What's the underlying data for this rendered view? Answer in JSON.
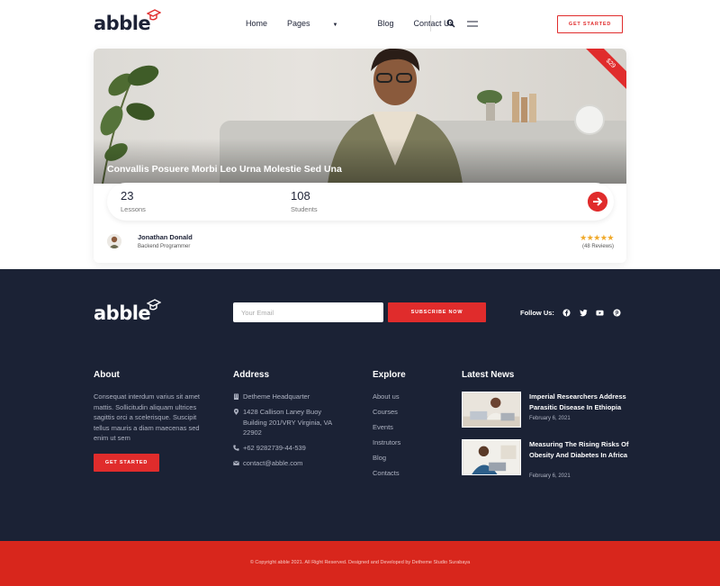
{
  "header": {
    "logo_text": "abble",
    "nav": [
      {
        "label": "Home"
      },
      {
        "label": "Pages"
      },
      {
        "label": "Blog"
      },
      {
        "label": "Contact Us"
      }
    ],
    "cta_label": "GET STARTED"
  },
  "course": {
    "price": "$29",
    "title": "Convallis Posuere Morbi Leo Urna Molestie Sed Una",
    "lessons_count": "23",
    "lessons_label": "Lessons",
    "students_count": "108",
    "students_label": "Students",
    "author_name": "Jonathan Donald",
    "author_role": "Backend Programmer",
    "rating_stars": "★★★★★",
    "reviews": "(48 Reviews)"
  },
  "footer": {
    "logo_text": "abble",
    "email_placeholder": "Your Email",
    "subscribe_label": "SUBSCRIBE NOW",
    "follow_label": "Follow Us:",
    "about": {
      "title": "About",
      "text": "Consequat interdum varius sit amet mattis. Sollicitudin aliquam ultrices sagittis orci a scelerisque. Suscipit tellus mauris a diam maecenas sed enim ut sem",
      "button": "GET STARTED"
    },
    "address": {
      "title": "Address",
      "hq": "Detheme Headquarter",
      "street": "1428 Callison Laney Buoy Building 201/VRY Virginia, VA 22902",
      "phone": "+62 9282739-44-539",
      "email": "contact@abble.com"
    },
    "explore": {
      "title": "Explore",
      "links": [
        "About us",
        "Courses",
        "Events",
        "Instrutors",
        "Blog",
        "Contacts"
      ]
    },
    "news": {
      "title": "Latest News",
      "items": [
        {
          "title": "Imperial Researchers Address Parasitic Disease In Ethiopia",
          "date": "February 6, 2021"
        },
        {
          "title": "Measuring The Rising Risks Of Obesity And Diabetes In Africa",
          "date": "February 6, 2021"
        }
      ]
    },
    "copyright": "© Copyright abble 2021. All Right Reserved. Designed and Developed by Detheme Studio Surabaya"
  },
  "colors": {
    "accent": "#e02c2c",
    "footer_bg": "#1b2235",
    "copyright_bg": "#d8261c",
    "star": "#f0a92a"
  }
}
